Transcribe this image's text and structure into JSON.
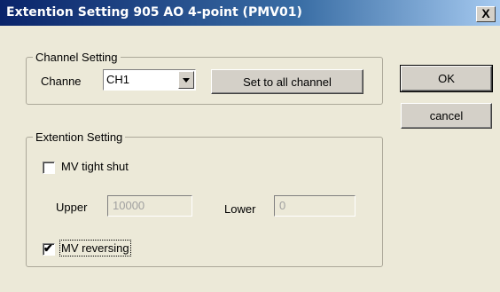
{
  "window": {
    "title": "Extention Setting 905 AO 4-point (PMV01)",
    "close_glyph": "X"
  },
  "channel_group": {
    "title": "Channel Setting",
    "channel_label": "Channe",
    "channel_value": "CH1",
    "set_all_label": "Set to all channel"
  },
  "extension_group": {
    "title": "Extention Setting",
    "tight_shut_label": "MV tight shut",
    "tight_shut_checked": false,
    "upper_label": "Upper",
    "upper_value": "10000",
    "lower_label": "Lower",
    "lower_value": "0",
    "reversing_label": "MV reversing",
    "reversing_checked": true,
    "check_glyph": "✔"
  },
  "buttons": {
    "ok": "OK",
    "cancel": "cancel"
  }
}
